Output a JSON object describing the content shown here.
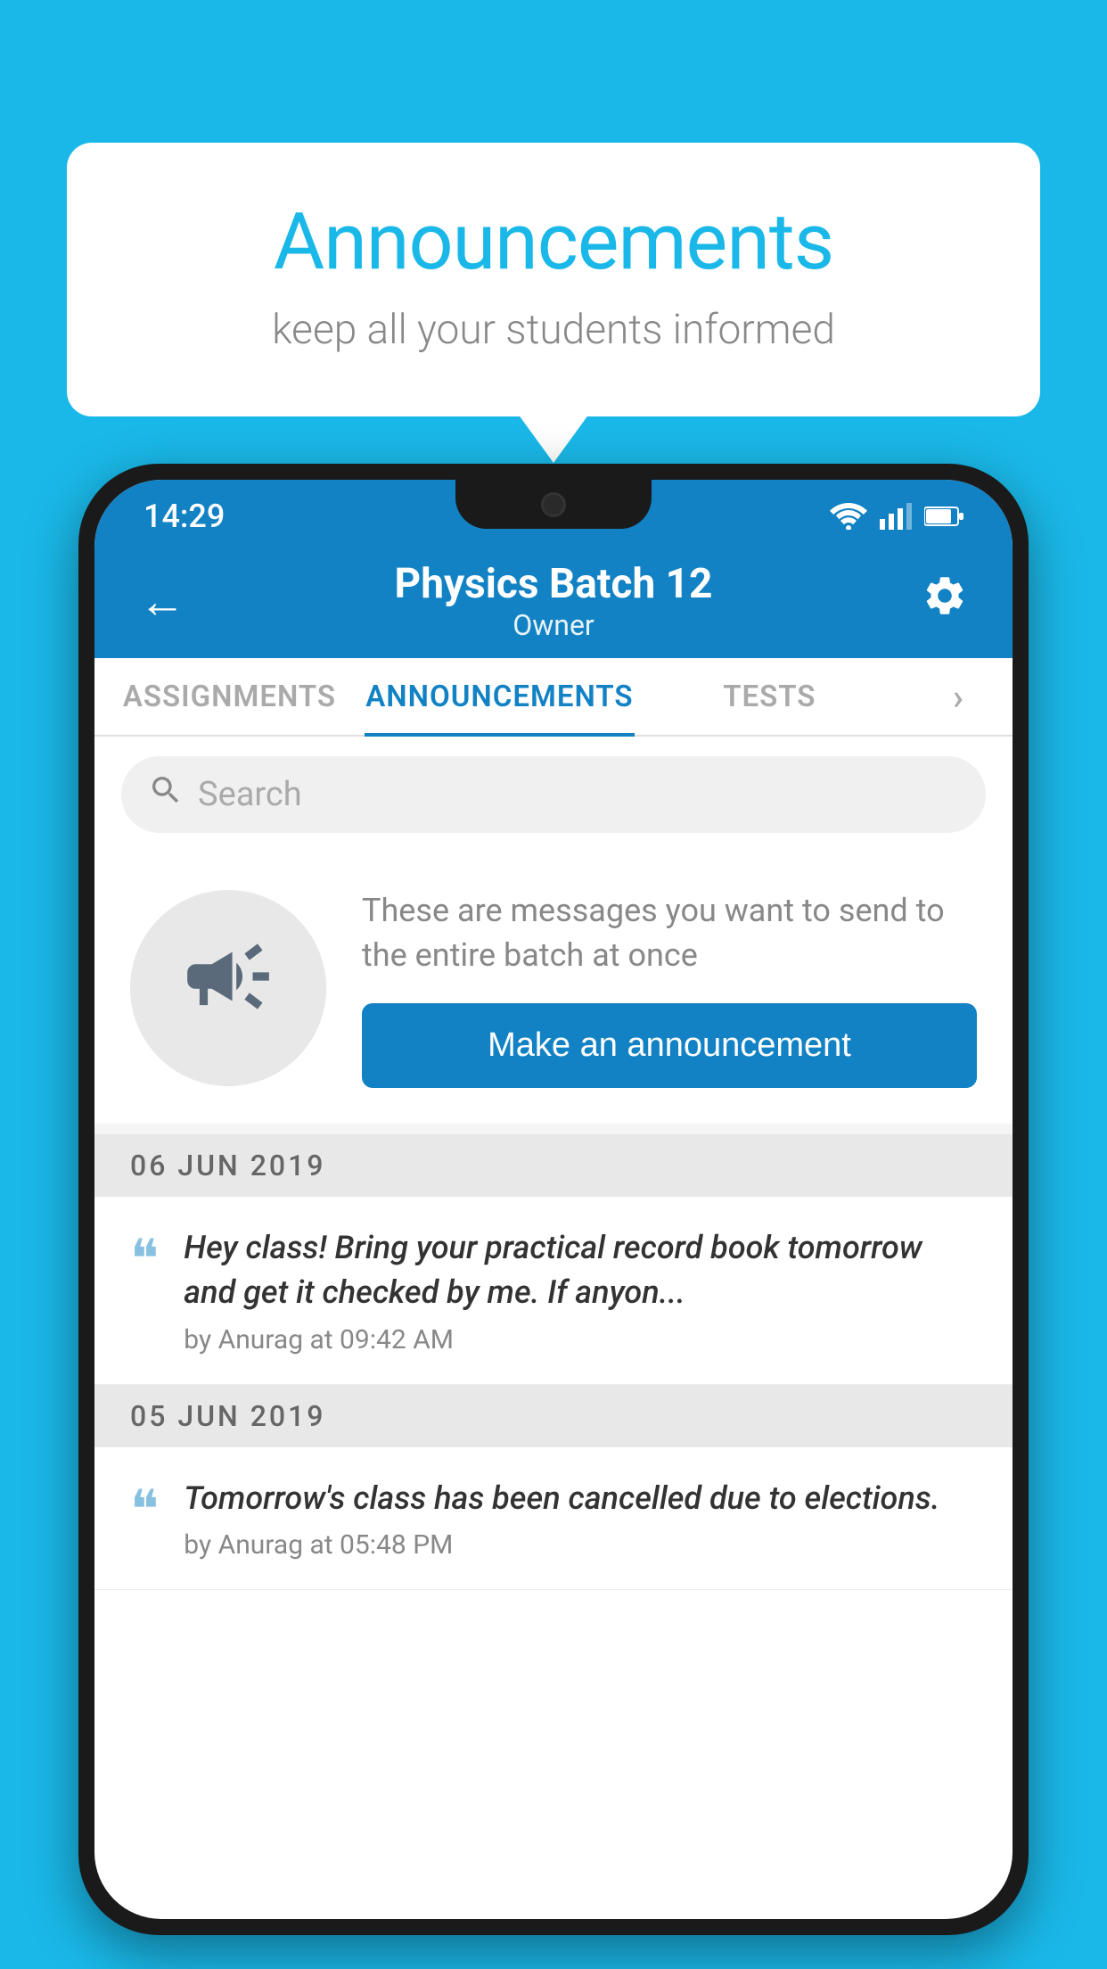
{
  "background_color": "#1ab8e8",
  "speech_bubble": {
    "title": "Announcements",
    "subtitle": "keep all your students informed"
  },
  "phone": {
    "status_bar": {
      "time": "14:29"
    },
    "header": {
      "back_label": "←",
      "title": "Physics Batch 12",
      "subtitle": "Owner",
      "gear_label": "⚙"
    },
    "tabs": [
      {
        "label": "ASSIGNMENTS",
        "active": false
      },
      {
        "label": "ANNOUNCEMENTS",
        "active": true
      },
      {
        "label": "TESTS",
        "active": false
      }
    ],
    "search": {
      "placeholder": "Search"
    },
    "cta_section": {
      "description": "These are messages you want to send to the entire batch at once",
      "button_label": "Make an announcement"
    },
    "announcements": [
      {
        "date": "06  JUN  2019",
        "body": "Hey class! Bring your practical record book tomorrow and get it checked by me. If anyon...",
        "meta": "by Anurag at 09:42 AM"
      },
      {
        "date": "05  JUN  2019",
        "body": "Tomorrow's class has been cancelled due to elections.",
        "meta": "by Anurag at 05:48 PM"
      }
    ]
  }
}
